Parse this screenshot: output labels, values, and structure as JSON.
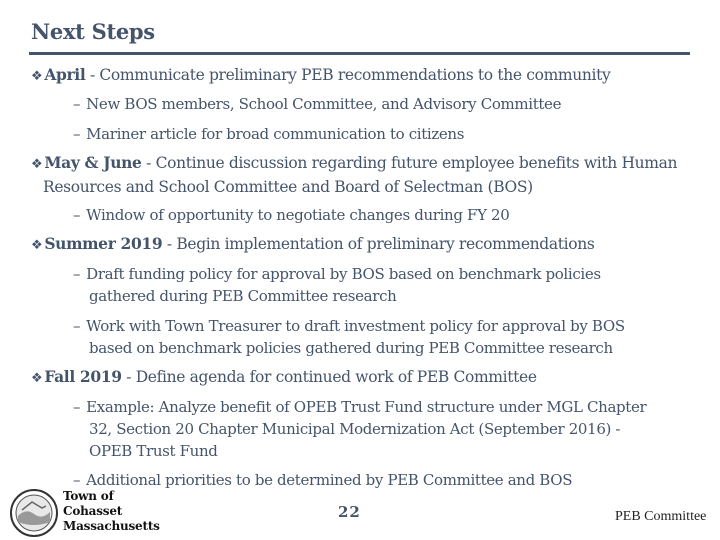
{
  "title": "Next Steps",
  "items": [
    {
      "label": "April",
      "text": " - Communicate preliminary PEB recommendations to the community",
      "subitems": [
        "New BOS members, School Committee, and Advisory Committee",
        "Mariner article for broad communication to citizens"
      ]
    },
    {
      "label": "May & June",
      "text": " - Continue discussion regarding future employee benefits with Human",
      "text_cont": "Resources and School Committee and Board of Selectman (BOS)",
      "subitems": [
        "Window of opportunity to negotiate changes during FY 20"
      ]
    },
    {
      "label": "Summer 2019",
      "text": " - Begin implementation of  preliminary recommendations",
      "subitems": [
        {
          "line1": "Draft funding policy for approval by BOS based on benchmark policies",
          "line2": "gathered during PEB Committee research"
        },
        {
          "line1": "Work with Town Treasurer to draft investment policy for approval by BOS",
          "line2": "based on benchmark policies gathered during PEB Committee research"
        }
      ]
    },
    {
      "label": "Fall 2019",
      "text": " - Define agenda for continued work of PEB Committee",
      "subitems": [
        {
          "line1": "Example: Analyze benefit of  OPEB Trust Fund structure under MGL Chapter",
          "line2": "32, Section 20 Chapter Municipal Modernization Act (September 2016) -",
          "line3": "OPEB Trust Fund"
        },
        "Additional priorities to be determined by PEB Committee and BOS"
      ]
    }
  ],
  "bullet_glyph": "❖",
  "dash_glyph": "–",
  "footer": {
    "logo_lines": [
      "Town of",
      "Cohasset",
      "Massachusetts"
    ],
    "page_number": "22",
    "right_text": "PEB Committee"
  }
}
